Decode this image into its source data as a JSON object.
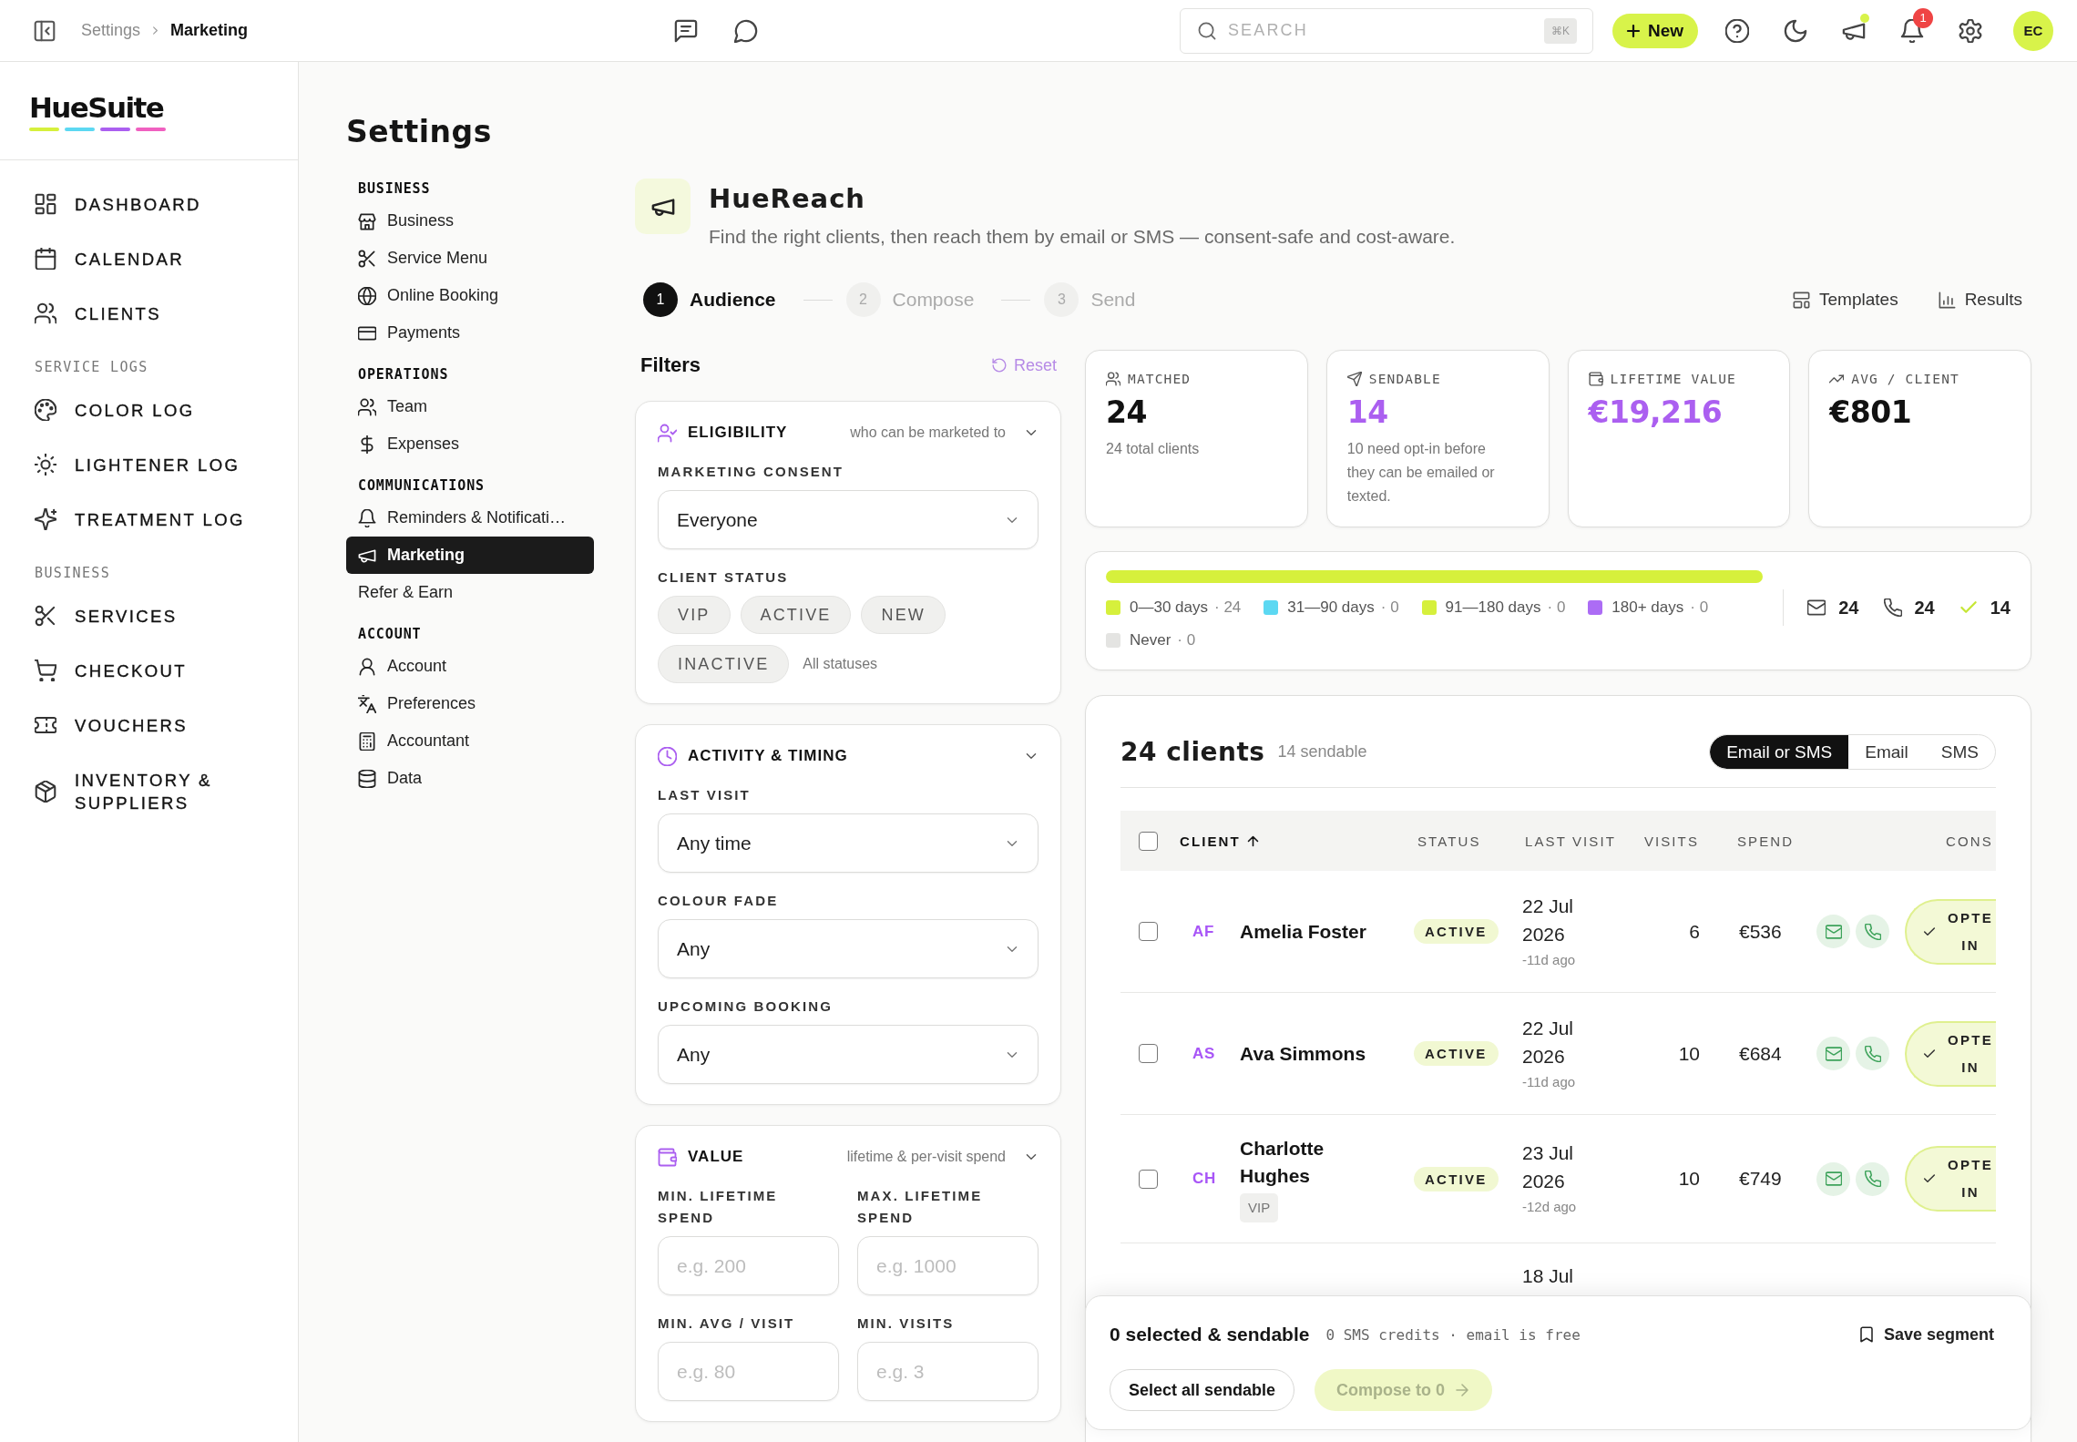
{
  "topbar": {
    "breadcrumb": [
      {
        "label": "Settings",
        "current": false
      },
      {
        "label": "Marketing",
        "current": true
      }
    ],
    "search": {
      "placeholder": "SEARCH",
      "shortcut": "⌘K"
    },
    "new_button": "New",
    "announcements_unread": true,
    "notifications": "1",
    "avatar": "EC"
  },
  "sidebar": {
    "logo": "HueSuite",
    "sections": [
      {
        "items": [
          {
            "label": "DASHBOARD",
            "selected": false
          },
          {
            "label": "CALENDAR",
            "selected": false
          },
          {
            "label": "CLIENTS",
            "selected": false
          }
        ]
      },
      {
        "heading": "SERVICE LOGS",
        "items": [
          {
            "label": "COLOR LOG",
            "selected": false
          },
          {
            "label": "LIGHTENER LOG",
            "selected": false
          },
          {
            "label": "TREATMENT LOG",
            "selected": false
          }
        ]
      },
      {
        "heading": "BUSINESS",
        "items": [
          {
            "label": "SERVICES",
            "selected": false
          },
          {
            "label": "CHECKOUT",
            "selected": false
          },
          {
            "label": "VOUCHERS",
            "selected": false
          },
          {
            "label": "INVENTORY & SUPPLIERS",
            "selected": false
          }
        ]
      }
    ]
  },
  "settings_nav": {
    "title": "Settings",
    "groups": [
      {
        "heading": "BUSINESS",
        "items": [
          {
            "label": "Business",
            "selected": false
          },
          {
            "label": "Service Menu",
            "selected": false
          },
          {
            "label": "Online Booking",
            "selected": false
          },
          {
            "label": "Payments",
            "selected": false
          }
        ]
      },
      {
        "heading": "OPERATIONS",
        "items": [
          {
            "label": "Team",
            "selected": false
          },
          {
            "label": "Expenses",
            "selected": false
          }
        ]
      },
      {
        "heading": "COMMUNICATIONS",
        "items": [
          {
            "label": "Reminders & Notificati…",
            "selected": false
          },
          {
            "label": "Marketing",
            "selected": true
          },
          {
            "label": "Refer & Earn",
            "selected": false
          }
        ]
      },
      {
        "heading": "ACCOUNT",
        "items": [
          {
            "label": "Account",
            "selected": false
          },
          {
            "label": "Preferences",
            "selected": false
          },
          {
            "label": "Accountant",
            "selected": false
          },
          {
            "label": "Data",
            "selected": false
          }
        ]
      }
    ]
  },
  "app_header": {
    "title": "HueReach",
    "subtitle": "Find the right clients, then reach them by email or SMS — consent-safe and cost-aware."
  },
  "steps": [
    {
      "number": "1",
      "label": "Audience",
      "selected": true
    },
    {
      "number": "2",
      "label": "Compose",
      "selected": false
    },
    {
      "number": "3",
      "label": "Send",
      "selected": false
    }
  ],
  "header_links": [
    {
      "label": "Templates"
    },
    {
      "label": "Results"
    }
  ],
  "filters": {
    "title": "Filters",
    "reset": {
      "label": "Reset",
      "disabled": true
    },
    "cards": [
      {
        "title": "ELIGIBILITY",
        "hint": "who can be marketed to",
        "expanded": true,
        "fields": [
          {
            "kind": "select",
            "label": "MARKETING CONSENT",
            "value": "Everyone"
          },
          {
            "kind": "chips",
            "label": "CLIENT STATUS",
            "chips": [
              {
                "label": "VIP",
                "selected": false
              },
              {
                "label": "ACTIVE",
                "selected": false
              },
              {
                "label": "NEW",
                "selected": false
              },
              {
                "label": "INACTIVE",
                "selected": false
              }
            ],
            "hint": "All statuses"
          }
        ]
      },
      {
        "title": "ACTIVITY & TIMING",
        "expanded": true,
        "fields": [
          {
            "kind": "select",
            "label": "LAST VISIT",
            "value": "Any time"
          },
          {
            "kind": "select",
            "label": "COLOUR FADE",
            "value": "Any"
          },
          {
            "kind": "select",
            "label": "UPCOMING BOOKING",
            "value": "Any"
          }
        ]
      },
      {
        "title": "VALUE",
        "hint": "lifetime & per-visit spend",
        "expanded": true,
        "fields": [
          {
            "kind": "input",
            "label": "MIN. LIFETIME SPEND",
            "placeholder": "e.g. 200"
          },
          {
            "kind": "input",
            "label": "MAX. LIFETIME SPEND",
            "placeholder": "e.g. 1000"
          },
          {
            "kind": "input",
            "label": "MIN. AVG / VISIT",
            "placeholder": "e.g. 80"
          },
          {
            "kind": "input",
            "label": "MIN. VISITS",
            "placeholder": "e.g. 3"
          }
        ]
      }
    ]
  },
  "stats": [
    {
      "label": "MATCHED",
      "value": "24",
      "color": "#111111",
      "note": "24 total clients"
    },
    {
      "label": "SENDABLE",
      "value": "14",
      "color": "#ab5ff0",
      "note": "10 need opt-in before they can be emailed or texted."
    },
    {
      "label": "LIFETIME VALUE",
      "value": "€19,216",
      "color": "#ab5ff0"
    },
    {
      "label": "AVG / CLIENT",
      "value": "€801",
      "color": "#111111"
    }
  ],
  "recency": {
    "segments": [
      {
        "label": "0—30 days",
        "count": "· 24",
        "color": "#d6f03c"
      },
      {
        "label": "31—90 days",
        "count": "· 0",
        "color": "#5cd8f2"
      },
      {
        "label": "91—180 days",
        "count": "· 0",
        "color": "#d6f03c"
      },
      {
        "label": "180+ days",
        "count": "· 0",
        "color": "#ac6cf5"
      },
      {
        "label": "Never",
        "count": "· 0",
        "color": "#e4e4e2"
      }
    ],
    "totals": [
      {
        "value": "24"
      },
      {
        "value": "24"
      },
      {
        "value": "14"
      }
    ]
  },
  "clients": {
    "title": "24 clients",
    "subtitle": "14 sendable",
    "channels": [
      {
        "label": "Email or SMS",
        "selected": true
      },
      {
        "label": "Email",
        "selected": false
      },
      {
        "label": "SMS",
        "selected": false
      }
    ],
    "select_all_checked": false,
    "columns": [
      {
        "label": "CLIENT",
        "sorted": true
      },
      {
        "label": "STATUS",
        "sorted": false
      },
      {
        "label": "LAST VISIT",
        "sorted": false
      },
      {
        "label": "VISITS",
        "sorted": false
      },
      {
        "label": "SPEND",
        "sorted": false
      },
      {
        "label": "CONS",
        "sorted": false
      }
    ],
    "rows": [
      {
        "checked": false,
        "initials": "AF",
        "name": "Amelia Foster",
        "status": "ACTIVE",
        "date": "22 Jul 2026",
        "ago": "-11d ago",
        "visits": "6",
        "spend": "€536",
        "email": true,
        "phone": true,
        "consent": "OPTE IN"
      },
      {
        "checked": false,
        "initials": "AS",
        "name": "Ava Simmons",
        "status": "ACTIVE",
        "date": "22 Jul 2026",
        "ago": "-11d ago",
        "visits": "10",
        "spend": "€684",
        "email": true,
        "phone": true,
        "consent": "OPTE IN"
      },
      {
        "checked": false,
        "initials": "CH",
        "name": "Charlotte Hughes",
        "tags": [
          "VIP"
        ],
        "status": "ACTIVE",
        "date": "23 Jul 2026",
        "ago": "-12d ago",
        "visits": "10",
        "spend": "€749",
        "email": true,
        "phone": true,
        "consent": "OPTE IN"
      },
      {
        "date": "18 Jul"
      }
    ]
  },
  "action_bar": {
    "title": "0 selected & sendable",
    "note": "0 SMS credits · email is free",
    "save": "Save segment",
    "select_all": "Select all sendable",
    "compose": {
      "label": "Compose to 0",
      "disabled": true
    }
  }
}
